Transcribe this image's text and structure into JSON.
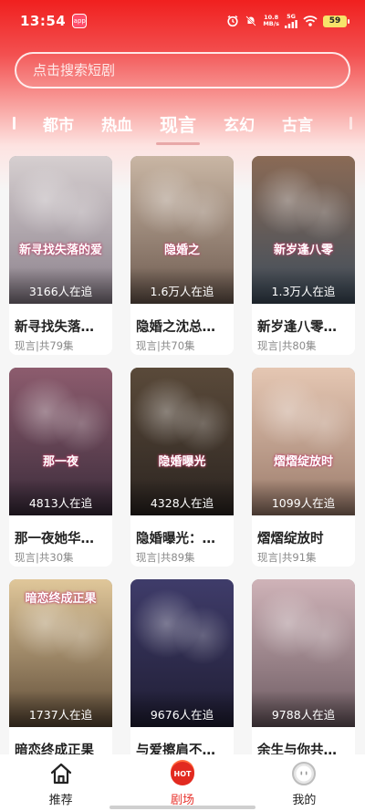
{
  "status_bar": {
    "time": "13:54",
    "app_badge": "app",
    "net_speed_top": "10.8",
    "net_speed_bottom": "MB/s",
    "signal_label": "5G",
    "battery": "59"
  },
  "search": {
    "placeholder": "点击搜索短剧"
  },
  "tabs": [
    {
      "label": "都市",
      "active": false
    },
    {
      "label": "热血",
      "active": false
    },
    {
      "label": "现言",
      "active": true
    },
    {
      "label": "玄幻",
      "active": false
    },
    {
      "label": "古言",
      "active": false
    }
  ],
  "cards": [
    {
      "title": "新寻找失落…",
      "meta": "现言|共79集",
      "followers": "3166人在追",
      "art_text": "新寻找失落的爱",
      "colors": [
        "#d6cfd0",
        "#8a7f8a"
      ]
    },
    {
      "title": "隐婚之沈总…",
      "meta": "现言|共70集",
      "followers": "1.6万人在追",
      "art_text": "隐婚之",
      "colors": [
        "#c9b6a4",
        "#6d5a4f"
      ]
    },
    {
      "title": "新岁逢八零…",
      "meta": "现言|共80集",
      "followers": "1.3万人在追",
      "art_text": "新岁逢八零",
      "colors": [
        "#8a6a55",
        "#3e4d5c"
      ]
    },
    {
      "title": "那一夜她华…",
      "meta": "现言|共30集",
      "followers": "4813人在追",
      "art_text": "那一夜",
      "colors": [
        "#8d5c6e",
        "#3a2b3a"
      ]
    },
    {
      "title": "隐婚曝光：…",
      "meta": "现言|共89集",
      "followers": "4328人在追",
      "art_text": "隐婚曝光",
      "colors": [
        "#5a4a3a",
        "#2b2420"
      ]
    },
    {
      "title": "熠熠绽放时",
      "meta": "现言|共91集",
      "followers": "1099人在追",
      "art_text": "熠熠绽放时",
      "colors": [
        "#e5c7b3",
        "#9a7a6a"
      ]
    },
    {
      "title": "暗恋终成正果",
      "meta": "",
      "followers": "1737人在追",
      "art_text": "暗恋终成正果",
      "colors": [
        "#e0c79a",
        "#5d4a36"
      ]
    },
    {
      "title": "与爱擦肩不…",
      "meta": "",
      "followers": "9676人在追",
      "art_text": "",
      "colors": [
        "#3f3c6a",
        "#1f1d33"
      ]
    },
    {
      "title": "余生与你共…",
      "meta": "",
      "followers": "9788人在追",
      "art_text": "",
      "colors": [
        "#cfb3b8",
        "#6b5960"
      ]
    }
  ],
  "bottom_nav": [
    {
      "label": "推荐",
      "icon": "home-icon",
      "active": false
    },
    {
      "label": "剧场",
      "icon": "hot-icon",
      "active": true,
      "badge": "HOT"
    },
    {
      "label": "我的",
      "icon": "profile-icon",
      "active": false
    }
  ],
  "colors": {
    "brand_red": "#e8352e",
    "header_top": "#f0201f",
    "page_bg": "#f6f6f6"
  }
}
